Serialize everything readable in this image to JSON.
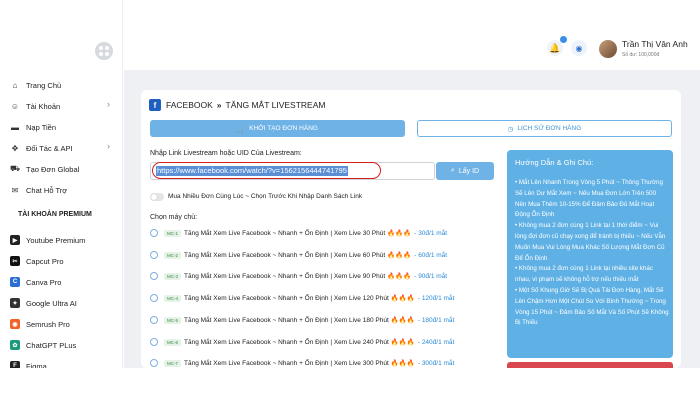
{
  "sidebar": {
    "items": [
      {
        "label": "Trang Chủ",
        "icon": "home-icon",
        "chevron": false
      },
      {
        "label": "Tài Khoản",
        "icon": "user-icon",
        "chevron": true
      },
      {
        "label": "Nạp Tiền",
        "icon": "card-icon",
        "chevron": false
      },
      {
        "label": "Đối Tác & API",
        "icon": "handshake-icon",
        "chevron": true
      },
      {
        "label": "Tạo Đơn Global",
        "icon": "cart-icon",
        "chevron": false
      },
      {
        "label": "Chat Hỗ Trợ",
        "icon": "chat-icon",
        "chevron": false
      }
    ],
    "premium_title": "TÀI KHOẢN PREMIUM",
    "premium_items": [
      {
        "label": "Youtube Premium",
        "icon": "youtube-icon",
        "color": "#222222"
      },
      {
        "label": "Capcut Pro",
        "icon": "capcut-icon",
        "color": "#111111"
      },
      {
        "label": "Canva Pro",
        "icon": "canva-icon",
        "color": "#2b6fd6"
      },
      {
        "label": "Google Ultra AI",
        "icon": "google-ai-icon",
        "color": "#333333"
      },
      {
        "label": "Semrush Pro",
        "icon": "semrush-icon",
        "color": "#f0642a"
      },
      {
        "label": "ChatGPT PLus",
        "icon": "chatgpt-icon",
        "color": "#1a9a7a"
      },
      {
        "label": "Figma",
        "icon": "figma-icon",
        "color": "#222222"
      }
    ]
  },
  "topbar": {
    "notification_count": "1",
    "user_name": "Trần Thị Vân Anh",
    "balance": "Số dư: 100,000đ"
  },
  "breadcrumb": {
    "section": "FACEBOOK",
    "page": "TĂNG MẮT LIVESTREAM"
  },
  "actions": {
    "create_label": "KHỞI TẠO ĐƠN HÀNG",
    "history_label": "LỊCH SỬ ĐƠN HÀNG"
  },
  "form": {
    "link_label": "Nhập Link Livestream hoặc UID Của Livestream:",
    "link_value": "https://www.facebook.com/watch/?v=1562156444741795",
    "get_id_label": "Lấy ID",
    "multi_toggle_label": "Mua Nhiều Đơn Cùng Lúc ~ Chọn Trước Khi Nhập Danh Sách Link",
    "multi_toggle_on": false,
    "servers_label": "Chọn máy chủ:"
  },
  "servers": [
    {
      "tag": "MC-1",
      "name": "Tăng Mắt Xem Live Facebook ~ Nhanh + Ổn Định | Xem Live 30 Phút 🔥🔥🔥",
      "price": "- 30đ/1 mắt"
    },
    {
      "tag": "MC-2",
      "name": "Tăng Mắt Xem Live Facebook ~ Nhanh + Ổn Định | Xem Live 60 Phút 🔥🔥🔥",
      "price": "- 60đ/1 mắt"
    },
    {
      "tag": "MC-3",
      "name": "Tăng Mắt Xem Live Facebook ~ Nhanh + Ổn Định | Xem Live 90 Phút 🔥🔥🔥",
      "price": "- 90đ/1 mắt"
    },
    {
      "tag": "MC-4",
      "name": "Tăng Mắt Xem Live Facebook ~ Nhanh + Ổn Định | Xem Live 120 Phút 🔥🔥🔥",
      "price": "- 120đ/1 mắt"
    },
    {
      "tag": "MC-5",
      "name": "Tăng Mắt Xem Live Facebook ~ Nhanh + Ổn Định | Xem Live 180 Phút 🔥🔥🔥",
      "price": "- 180đ/1 mắt"
    },
    {
      "tag": "MC-6",
      "name": "Tăng Mắt Xem Live Facebook ~ Nhanh + Ổn Định | Xem Live 240 Phút 🔥🔥🔥",
      "price": "- 240đ/1 mắt"
    },
    {
      "tag": "MC-7",
      "name": "Tăng Mắt Xem Live Facebook ~ Nhanh + Ổn Định | Xem Live 300 Phút 🔥🔥🔥",
      "price": "- 300đ/1 mắt"
    }
  ],
  "guide": {
    "title": "Hướng Dẫn & Ghi Chú:",
    "notes": [
      "• Mắt Lên Nhanh Trong Vòng 5 Phút ~ Thông Thường Sẽ Lên Dư Mắt Xem ~ Nếu Mua Đơn Lớn Trên 500 Nên Mua Thêm 10-15% Để Đảm Bảo Đủ Mắt Hoạt Động Ổn Định",
      "• Không mua 2 đơn cùng 1 Link tại 1 thời điểm ~ Vui lòng đợi đơn cũ chạy xong để tránh bị thiếu ~ Nếu Vẫn Muốn Mua Vui Lòng Mua Khác Số Lượng Mắt Đơn Cũ Để Ổn Định",
      "• Không mua 2 đơn cùng 1 Link tại nhiều site khác nhau, vì phạm sẽ không hỗ trợ nếu thiếu mắt",
      "• Một Số Khung Giờ Sẽ Bị Quá Tải Đơn Hàng, Mắt Sẽ Lên Chậm Hơn Một Chút So Với Bình Thường ~ Trong Vòng 15 Phút ~ Đảm Bảo Số Mắt Và Số Phút Sẽ Không Bị Thiếu"
    ]
  },
  "colors": {
    "accent": "#6fb3e6",
    "highlight_ring": "#d81b1b",
    "guide_bg": "#5fb0e4",
    "price": "#2a8ad6"
  }
}
